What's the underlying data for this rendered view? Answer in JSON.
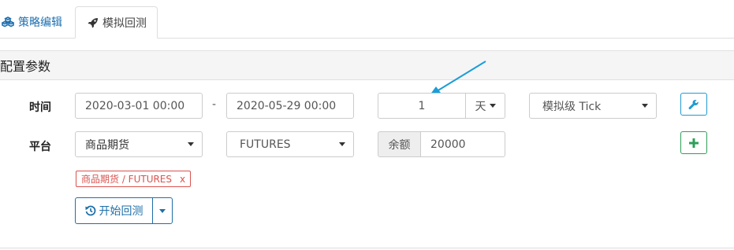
{
  "tabs": [
    {
      "label": "策略编辑",
      "icon": "cubes-icon",
      "active": false
    },
    {
      "label": "模拟回测",
      "icon": "rocket-icon",
      "active": true
    }
  ],
  "section": {
    "title": "配置参数"
  },
  "time": {
    "label": "时间",
    "start": "2020-03-01 00:00",
    "separator": "-",
    "end": "2020-05-29 00:00",
    "period_value": "1",
    "period_unit": "天",
    "level": "模拟级 Tick"
  },
  "platform": {
    "label": "平台",
    "exchange": "商品期货",
    "type": "FUTURES",
    "balance_label": "余额",
    "balance_value": "20000"
  },
  "tag": {
    "text": "商品期货 / FUTURES",
    "remove": "x"
  },
  "run": {
    "label": "开始回测"
  },
  "colors": {
    "accent": "#1f70b0",
    "success": "#2ca05a",
    "arrow": "#1b9dd8",
    "danger": "#d9534f"
  }
}
